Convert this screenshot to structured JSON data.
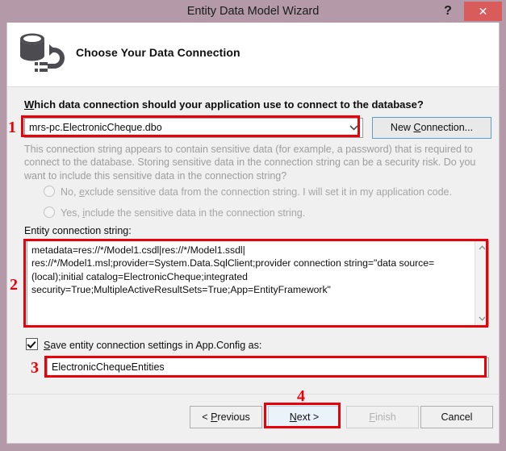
{
  "window": {
    "title": "Entity Data Model Wizard",
    "help_label": "?",
    "close_label": "✕",
    "titlebar_color": "#b49aa8",
    "close_color": "#d95c5c"
  },
  "header": {
    "icon": "database-connection-icon",
    "title": "Choose Your Data Connection"
  },
  "main": {
    "question_prefix": "W",
    "question_rest": "hich data connection should your application use to connect to the database?",
    "connection_combo": {
      "value": "mrs-pc.ElectronicCheque.dbo",
      "arrow": "⌄"
    },
    "new_connection_button": {
      "pre": "New ",
      "accel": "C",
      "post": "onnection..."
    },
    "warning_text": "This connection string appears to contain sensitive data (for example, a password) that is required to connect to the database. Storing sensitive data in the connection string can be a security risk. Do you want to include this sensitive data in the connection string?",
    "radio_options": [
      {
        "pre": "No, ",
        "accel": "e",
        "post": "xclude sensitive data from the connection string. I will set it in my application code.",
        "selected": false
      },
      {
        "pre": "Yes, ",
        "accel": "i",
        "post": "nclude the sensitive data in the connection string.",
        "selected": false
      }
    ],
    "entity_connection_label": "Entity connection string:",
    "entity_connection_string": "metadata=res://*/Model1.csdl|res://*/Model1.ssdl|\nres://*/Model1.msl;provider=System.Data.SqlClient;provider connection string=\"data source=(local);initial catalog=ElectronicCheque;integrated security=True;MultipleActiveResultSets=True;App=EntityFramework\"",
    "scroll_up": "⌃",
    "scroll_down": "⌄",
    "save_checkbox": {
      "checked": true,
      "accel": "S",
      "label_rest": "ave entity connection settings in App.Config as:"
    },
    "save_name_value": "ElectronicChequeEntities"
  },
  "footer": {
    "previous": {
      "pre": "< ",
      "accel": "P",
      "post": "revious"
    },
    "next": {
      "pre": "",
      "accel": "N",
      "post": "ext >"
    },
    "finish": {
      "pre": "",
      "accel": "F",
      "post": "inish"
    },
    "cancel": {
      "pre": "",
      "accel": "",
      "post": "Cancel"
    }
  },
  "annotations": {
    "color": "#e8000b",
    "items": [
      {
        "number": "1",
        "target": "connection-combo"
      },
      {
        "number": "2",
        "target": "entity-connection-string"
      },
      {
        "number": "3",
        "target": "save-name-input"
      },
      {
        "number": "4",
        "target": "next-button"
      }
    ]
  }
}
